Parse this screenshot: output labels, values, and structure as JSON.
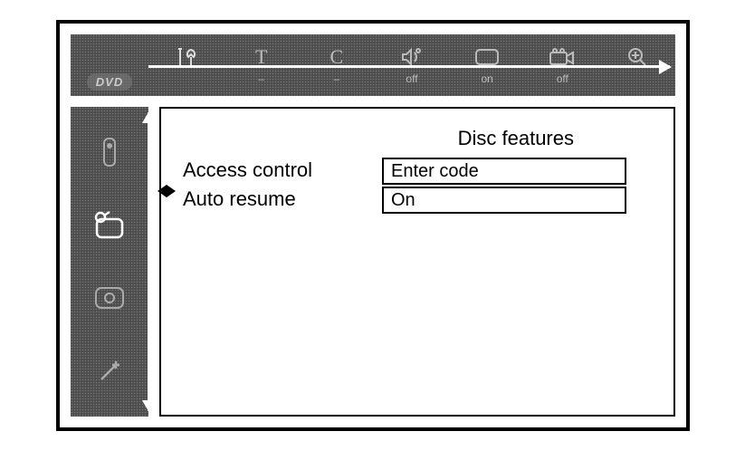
{
  "topbar": {
    "dvd_label": "DVD",
    "items": [
      {
        "icon": "tools-icon",
        "sub": ""
      },
      {
        "icon": "letter-t-icon",
        "sub": "–"
      },
      {
        "icon": "letter-c-icon",
        "sub": "–"
      },
      {
        "icon": "speaker-icon",
        "sub": "off"
      },
      {
        "icon": "screen-icon",
        "sub": "on"
      },
      {
        "icon": "camera-icon",
        "sub": "off"
      },
      {
        "icon": "zoom-icon",
        "sub": ""
      }
    ]
  },
  "sidebar": {
    "items": [
      {
        "icon": "remote-icon",
        "selected": false
      },
      {
        "icon": "tv-icon",
        "selected": true
      },
      {
        "icon": "record-icon",
        "selected": false
      },
      {
        "icon": "wand-icon",
        "selected": false
      }
    ]
  },
  "panel": {
    "title": "Disc features",
    "rows": [
      {
        "label": "Access control",
        "value": "Enter code"
      },
      {
        "label": "Auto resume",
        "value": "On"
      }
    ]
  }
}
